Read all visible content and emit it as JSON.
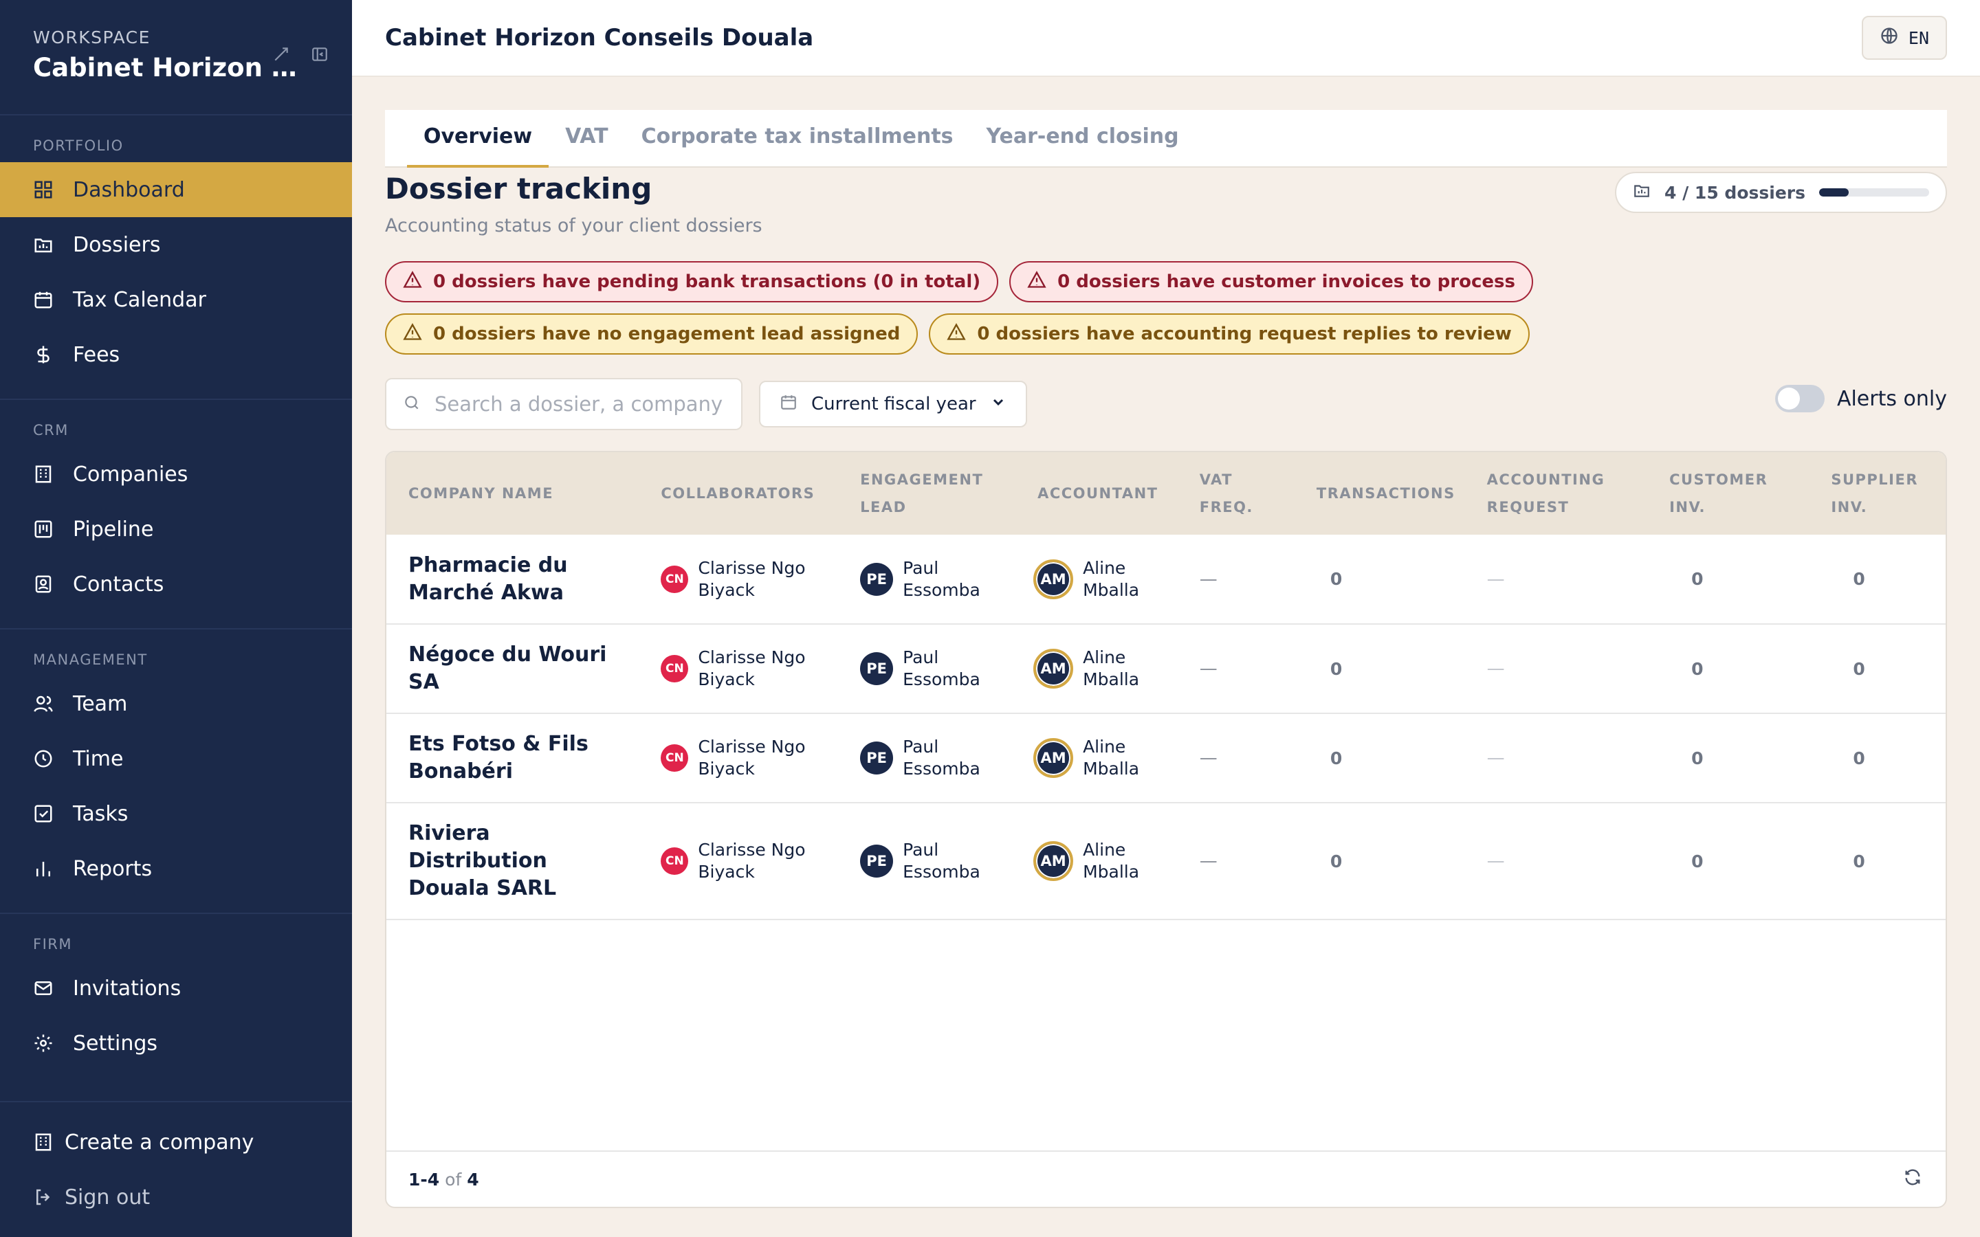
{
  "sidebar": {
    "workspace_label": "WORKSPACE",
    "workspace_name": "Cabinet Horizon Conseils Douala",
    "sections": [
      {
        "label": "PORTFOLIO",
        "items": [
          {
            "label": "Dashboard",
            "icon": "dashboard-icon",
            "active": true
          },
          {
            "label": "Dossiers",
            "icon": "folder-icon"
          },
          {
            "label": "Tax Calendar",
            "icon": "calendar-icon"
          },
          {
            "label": "Fees",
            "icon": "dollar-icon"
          }
        ]
      },
      {
        "label": "CRM",
        "items": [
          {
            "label": "Companies",
            "icon": "building-icon"
          },
          {
            "label": "Pipeline",
            "icon": "pipeline-icon"
          },
          {
            "label": "Contacts",
            "icon": "contacts-icon"
          }
        ]
      },
      {
        "label": "MANAGEMENT",
        "items": [
          {
            "label": "Team",
            "icon": "team-icon"
          },
          {
            "label": "Time",
            "icon": "clock-icon"
          },
          {
            "label": "Tasks",
            "icon": "tasks-icon"
          },
          {
            "label": "Reports",
            "icon": "reports-icon"
          }
        ]
      },
      {
        "label": "FIRM",
        "items": [
          {
            "label": "Invitations",
            "icon": "mail-icon"
          },
          {
            "label": "Settings",
            "icon": "gear-icon"
          }
        ]
      }
    ],
    "footer": {
      "create_company": "Create a company",
      "sign_out": "Sign out"
    }
  },
  "topbar": {
    "title": "Cabinet Horizon Conseils Douala",
    "language": "EN"
  },
  "tabs": [
    {
      "label": "Overview",
      "active": true
    },
    {
      "label": "VAT"
    },
    {
      "label": "Corporate tax installments"
    },
    {
      "label": "Year-end closing"
    }
  ],
  "page": {
    "title": "Dossier tracking",
    "subtitle": "Accounting status of your client dossiers",
    "progress_label": "4 / 15 dossiers",
    "progress_fraction": 0.27
  },
  "alerts": [
    {
      "text": "0 dossiers have pending bank transactions (0 in total)",
      "level": "red"
    },
    {
      "text": "0 dossiers have customer invoices to process",
      "level": "red"
    },
    {
      "text": "0 dossiers have no engagement lead assigned",
      "level": "yellow"
    },
    {
      "text": "0 dossiers have accounting request replies to review",
      "level": "yellow"
    }
  ],
  "filters": {
    "search_placeholder": "Search a dossier, a company name…",
    "fiscal_year": "Current fiscal year",
    "alerts_only_label": "Alerts only",
    "alerts_only": false
  },
  "table": {
    "columns": [
      "COMPANY NAME",
      "COLLABORATORS",
      "ENGAGEMENT LEAD",
      "ACCOUNTANT",
      "VAT FREQ.",
      "TRANSACTIONS",
      "ACCOUNTING REQUEST",
      "CUSTOMER INV.",
      "SUPPLIER INV."
    ],
    "rows": [
      {
        "company": "Pharmacie du Marché Akwa",
        "collab_initials": "CN",
        "collab_name": "Clarisse Ngo Biyack",
        "lead_initials": "PE",
        "lead_name": "Paul Essomba",
        "acc_initials": "AM",
        "acc_name": "Aline Mballa",
        "vat": "—",
        "transactions": "0",
        "request": "—",
        "customer_inv": "0",
        "supplier_inv": "0"
      },
      {
        "company": "Négoce du Wouri SA",
        "collab_initials": "CN",
        "collab_name": "Clarisse Ngo Biyack",
        "lead_initials": "PE",
        "lead_name": "Paul Essomba",
        "acc_initials": "AM",
        "acc_name": "Aline Mballa",
        "vat": "—",
        "transactions": "0",
        "request": "—",
        "customer_inv": "0",
        "supplier_inv": "0"
      },
      {
        "company": "Ets Fotso & Fils Bonabéri",
        "collab_initials": "CN",
        "collab_name": "Clarisse Ngo Biyack",
        "lead_initials": "PE",
        "lead_name": "Paul Essomba",
        "acc_initials": "AM",
        "acc_name": "Aline Mballa",
        "vat": "—",
        "transactions": "0",
        "request": "—",
        "customer_inv": "0",
        "supplier_inv": "0"
      },
      {
        "company": "Riviera Distribution Douala SARL",
        "collab_initials": "CN",
        "collab_name": "Clarisse Ngo Biyack",
        "lead_initials": "PE",
        "lead_name": "Paul Essomba",
        "acc_initials": "AM",
        "acc_name": "Aline Mballa",
        "vat": "—",
        "transactions": "0",
        "request": "—",
        "customer_inv": "0",
        "supplier_inv": "0"
      }
    ],
    "pagination": {
      "from": "1",
      "to": "4",
      "of_label": "of",
      "total": "4"
    }
  },
  "colors": {
    "sidebar_bg": "#1b2949",
    "accent": "#d4a843",
    "page_bg": "#f6efe8",
    "alert_red": "#a5263a",
    "alert_yellow": "#b98a1c"
  }
}
